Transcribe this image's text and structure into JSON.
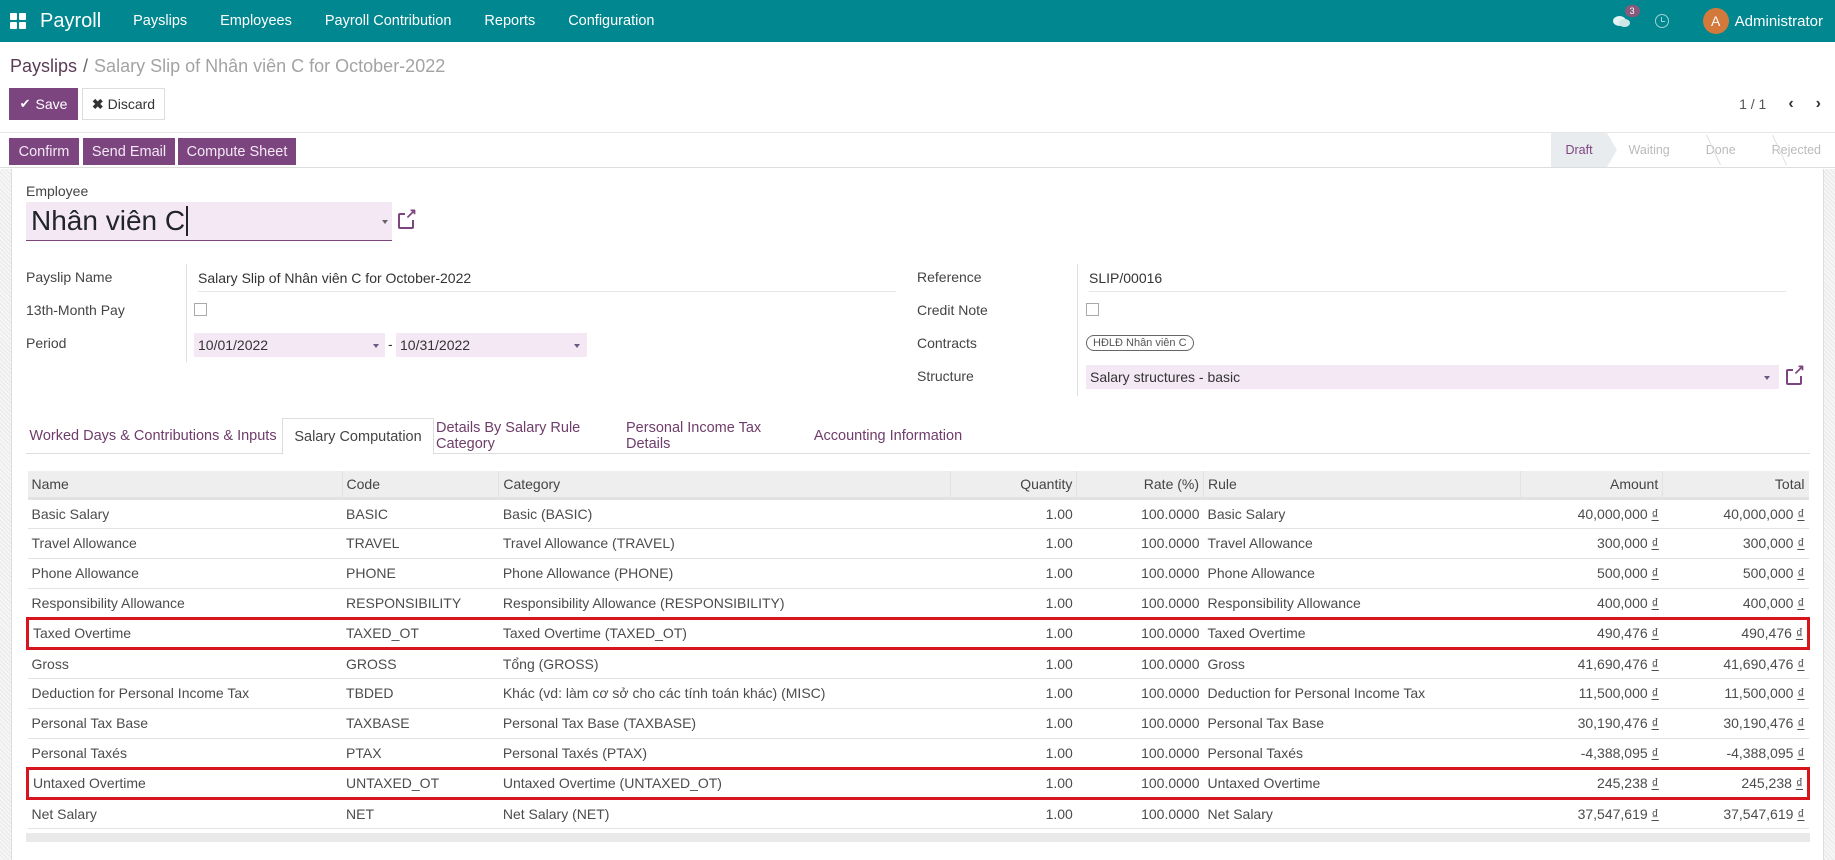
{
  "topbar": {
    "app_name": "Payroll",
    "menu": [
      "Payslips",
      "Employees",
      "Payroll Contribution",
      "Reports",
      "Configuration"
    ],
    "message_count": "3",
    "user_initial": "A",
    "user_name": "Administrator"
  },
  "breadcrumb": {
    "parent": "Payslips",
    "separator": "/",
    "current": "Salary Slip of Nhân viên C for October-2022"
  },
  "toolbar": {
    "save_label": "Save",
    "discard_label": "Discard",
    "pager": "1 / 1"
  },
  "actions": {
    "confirm": "Confirm",
    "send_email": "Send Email",
    "compute_sheet": "Compute Sheet"
  },
  "states": {
    "items": [
      "Draft",
      "Waiting",
      "Done",
      "Rejected"
    ],
    "current": "Draft"
  },
  "form": {
    "employee_label": "Employee",
    "employee_value": "Nhân viên C",
    "payslip_name_label": "Payslip Name",
    "payslip_name_value": "Salary Slip of Nhân viên C for October-2022",
    "thirteenth_label": "13th-Month Pay",
    "thirteenth_checked": false,
    "period_label": "Period",
    "period_from": "10/01/2022",
    "period_sep": "-",
    "period_to": "10/31/2022",
    "reference_label": "Reference",
    "reference_value": "SLIP/00016",
    "credit_note_label": "Credit Note",
    "credit_note_checked": false,
    "contracts_label": "Contracts",
    "contracts_tag": "HĐLĐ Nhân viên C",
    "structure_label": "Structure",
    "structure_value": "Salary structures - basic"
  },
  "tabs": {
    "items": [
      "Worked Days & Contributions & Inputs",
      "Salary Computation",
      "Details By Salary Rule Category",
      "Personal Income Tax Details",
      "Accounting Information"
    ],
    "active": "Salary Computation"
  },
  "table": {
    "columns": [
      "Name",
      "Code",
      "Category",
      "Quantity",
      "Rate (%)",
      "Rule",
      "Amount",
      "Total"
    ],
    "currency": "₫",
    "rows": [
      {
        "name": "Basic Salary",
        "code": "BASIC",
        "category": "Basic (BASIC)",
        "quantity": "1.00",
        "rate": "100.0000",
        "rule": "Basic Salary",
        "amount": "40,000,000",
        "total": "40,000,000",
        "highlighted": false
      },
      {
        "name": "Travel Allowance",
        "code": "TRAVEL",
        "category": "Travel Allowance (TRAVEL)",
        "quantity": "1.00",
        "rate": "100.0000",
        "rule": "Travel Allowance",
        "amount": "300,000",
        "total": "300,000",
        "highlighted": false
      },
      {
        "name": "Phone Allowance",
        "code": "PHONE",
        "category": "Phone Allowance (PHONE)",
        "quantity": "1.00",
        "rate": "100.0000",
        "rule": "Phone Allowance",
        "amount": "500,000",
        "total": "500,000",
        "highlighted": false
      },
      {
        "name": "Responsibility Allowance",
        "code": "RESPONSIBILITY",
        "category": "Responsibility Allowance (RESPONSIBILITY)",
        "quantity": "1.00",
        "rate": "100.0000",
        "rule": "Responsibility Allowance",
        "amount": "400,000",
        "total": "400,000",
        "highlighted": false
      },
      {
        "name": "Taxed Overtime",
        "code": "TAXED_OT",
        "category": "Taxed Overtime (TAXED_OT)",
        "quantity": "1.00",
        "rate": "100.0000",
        "rule": "Taxed Overtime",
        "amount": "490,476",
        "total": "490,476",
        "highlighted": true
      },
      {
        "name": "Gross",
        "code": "GROSS",
        "category": "Tổng (GROSS)",
        "quantity": "1.00",
        "rate": "100.0000",
        "rule": "Gross",
        "amount": "41,690,476",
        "total": "41,690,476",
        "highlighted": false
      },
      {
        "name": "Deduction for Personal Income Tax",
        "code": "TBDED",
        "category": "Khác (vd: làm cơ sở cho các tính toán khác) (MISC)",
        "quantity": "1.00",
        "rate": "100.0000",
        "rule": "Deduction for Personal Income Tax",
        "amount": "11,500,000",
        "total": "11,500,000",
        "highlighted": false
      },
      {
        "name": "Personal Tax Base",
        "code": "TAXBASE",
        "category": "Personal Tax Base (TAXBASE)",
        "quantity": "1.00",
        "rate": "100.0000",
        "rule": "Personal Tax Base",
        "amount": "30,190,476",
        "total": "30,190,476",
        "highlighted": false
      },
      {
        "name": "Personal Taxés",
        "code": "PTAX",
        "category": "Personal Taxés (PTAX)",
        "quantity": "1.00",
        "rate": "100.0000",
        "rule": "Personal Taxés",
        "amount": "-4,388,095",
        "total": "-4,388,095",
        "highlighted": false
      },
      {
        "name": "Untaxed Overtime",
        "code": "UNTAXED_OT",
        "category": "Untaxed Overtime (UNTAXED_OT)",
        "quantity": "1.00",
        "rate": "100.0000",
        "rule": "Untaxed Overtime",
        "amount": "245,238",
        "total": "245,238",
        "highlighted": true
      },
      {
        "name": "Net Salary",
        "code": "NET",
        "category": "Net Salary (NET)",
        "quantity": "1.00",
        "rate": "100.0000",
        "rule": "Net Salary",
        "amount": "37,547,619",
        "total": "37,547,619",
        "highlighted": false
      }
    ]
  },
  "colors": {
    "topbar": "#00878f",
    "primary": "#7c4580",
    "highlight_border": "#d7151f",
    "input_bg": "#f4e8f4"
  }
}
